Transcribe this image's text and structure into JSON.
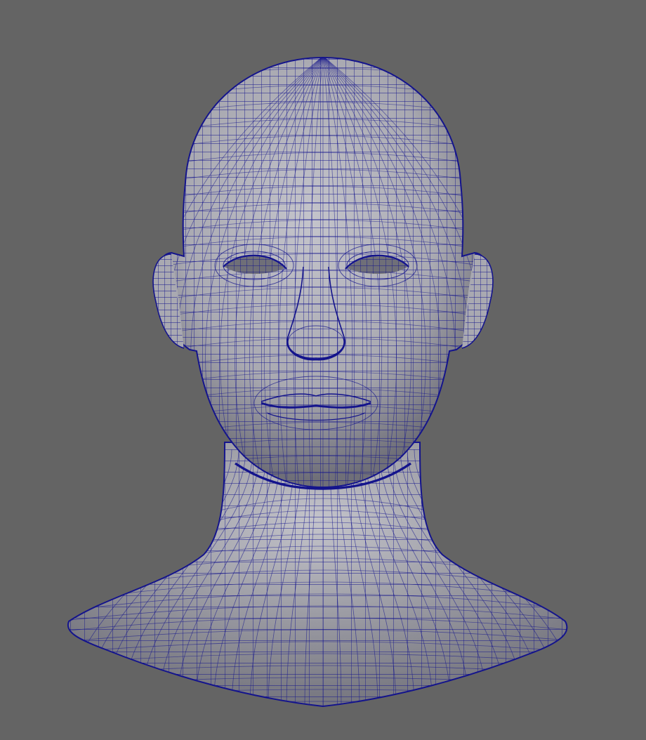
{
  "viewport": {
    "background_color": "#646464",
    "subject": "head-bust-mesh",
    "display_mode": "wireframe-on-shaded"
  },
  "mesh": {
    "surface_color": "#a9a9b1",
    "surface_light_color": "#c4c4cb",
    "surface_shadow_color": "#6f6f78",
    "wire_color": "#14148c"
  }
}
